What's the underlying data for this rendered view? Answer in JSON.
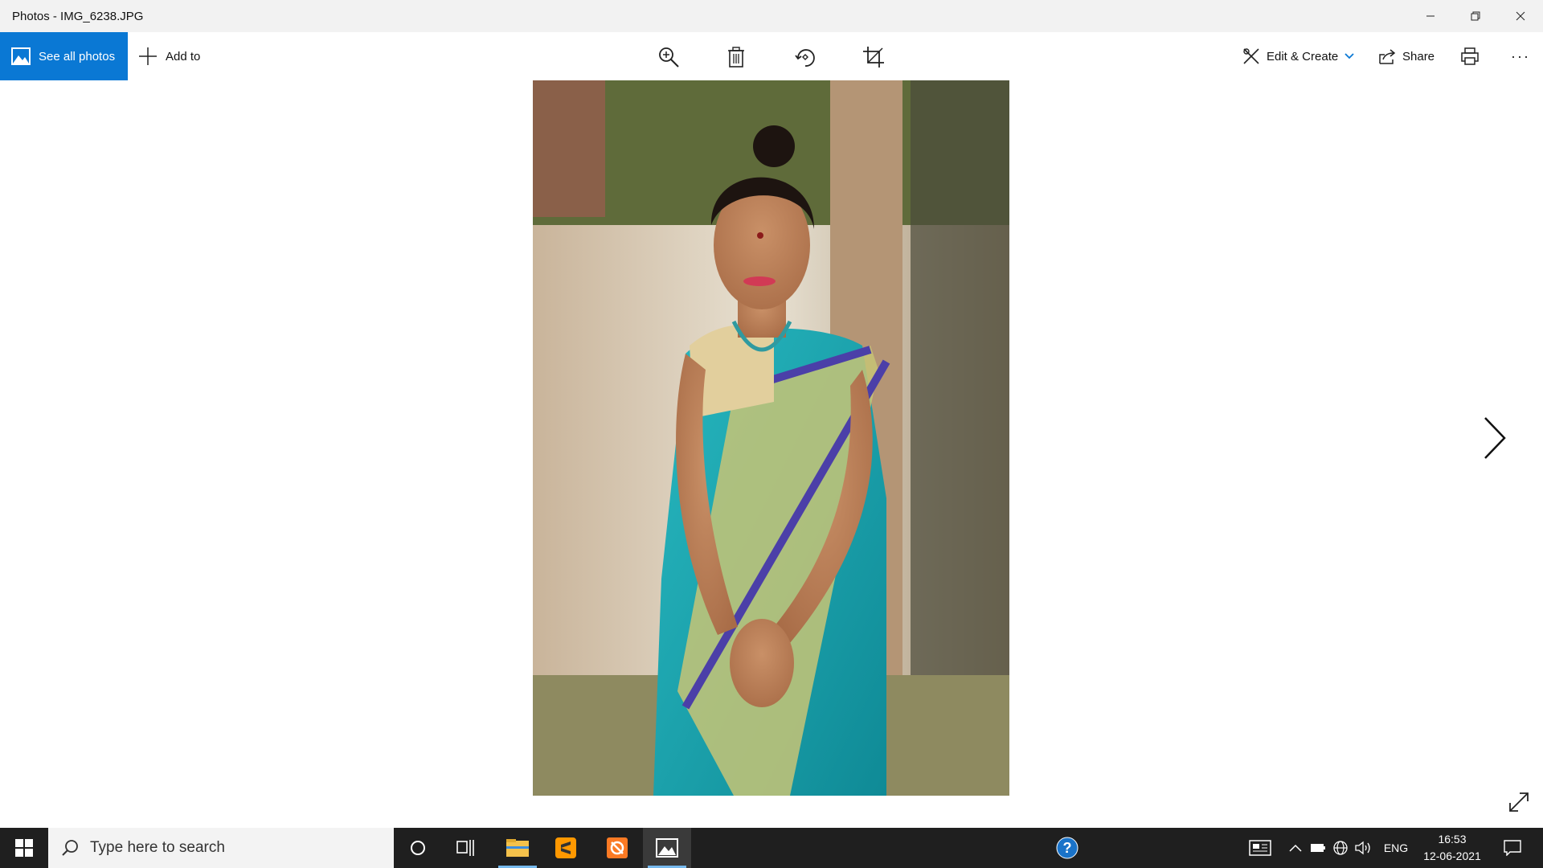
{
  "window": {
    "title": "Photos - IMG_6238.JPG"
  },
  "toolbar": {
    "see_all_label": "See all photos",
    "add_to_label": "Add to",
    "edit_create_label": "Edit & Create",
    "share_label": "Share",
    "more_label": "···"
  },
  "taskbar": {
    "search_placeholder": "Type here to search",
    "language": "ENG",
    "time": "16:53",
    "date": "12-06-2021"
  },
  "colors": {
    "accent": "#0a78d4",
    "taskbar": "#1f1f1f",
    "saree": "#1ba5b3"
  }
}
